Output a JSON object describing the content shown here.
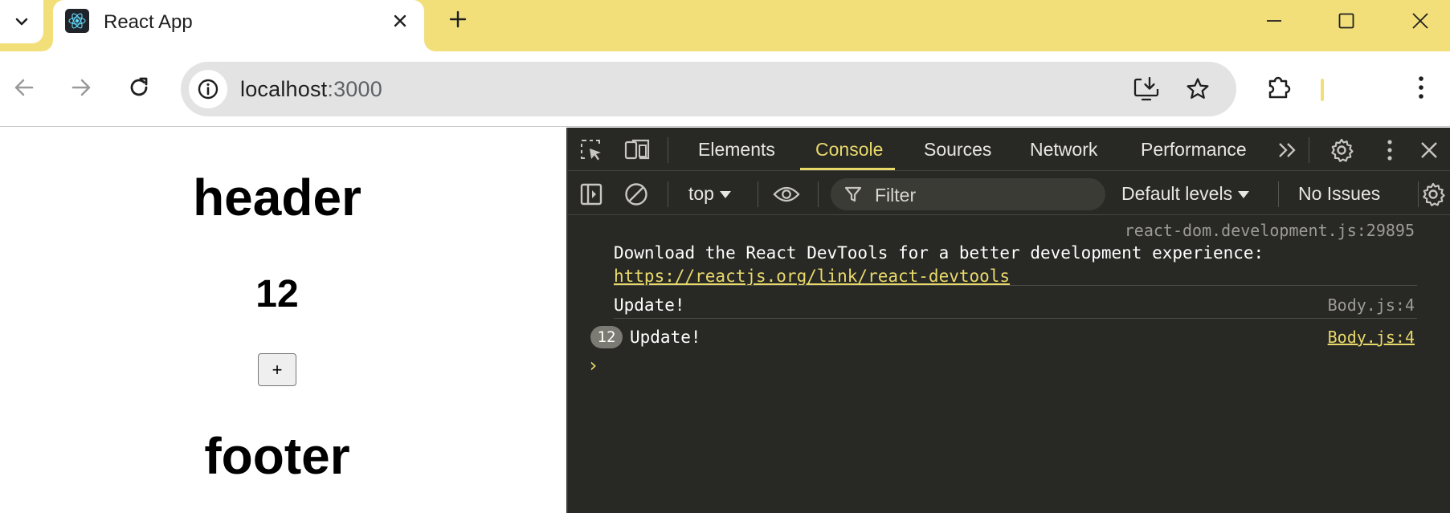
{
  "browser": {
    "tab_title": "React App",
    "url_host": "localhost",
    "url_port": ":3000",
    "accent_color": "#f2df7a"
  },
  "page": {
    "header": "header",
    "count": "12",
    "plus_label": "+",
    "footer": "footer"
  },
  "devtools": {
    "tabs": [
      "Elements",
      "Console",
      "Sources",
      "Network",
      "Performance"
    ],
    "active_tab": "Console",
    "context": "top",
    "filter_placeholder": "Filter",
    "levels": "Default levels",
    "issues": "No Issues",
    "messages": [
      {
        "source": "react-dom.development.js:29895",
        "text": "Download the React DevTools for a better development experience:",
        "link": "https://reactjs.org/link/react-devtools"
      },
      {
        "source": "Body.js:4",
        "text": "Update!"
      },
      {
        "count": "12",
        "source": "Body.js:4",
        "text": "Update!"
      }
    ],
    "prompt": "›"
  }
}
